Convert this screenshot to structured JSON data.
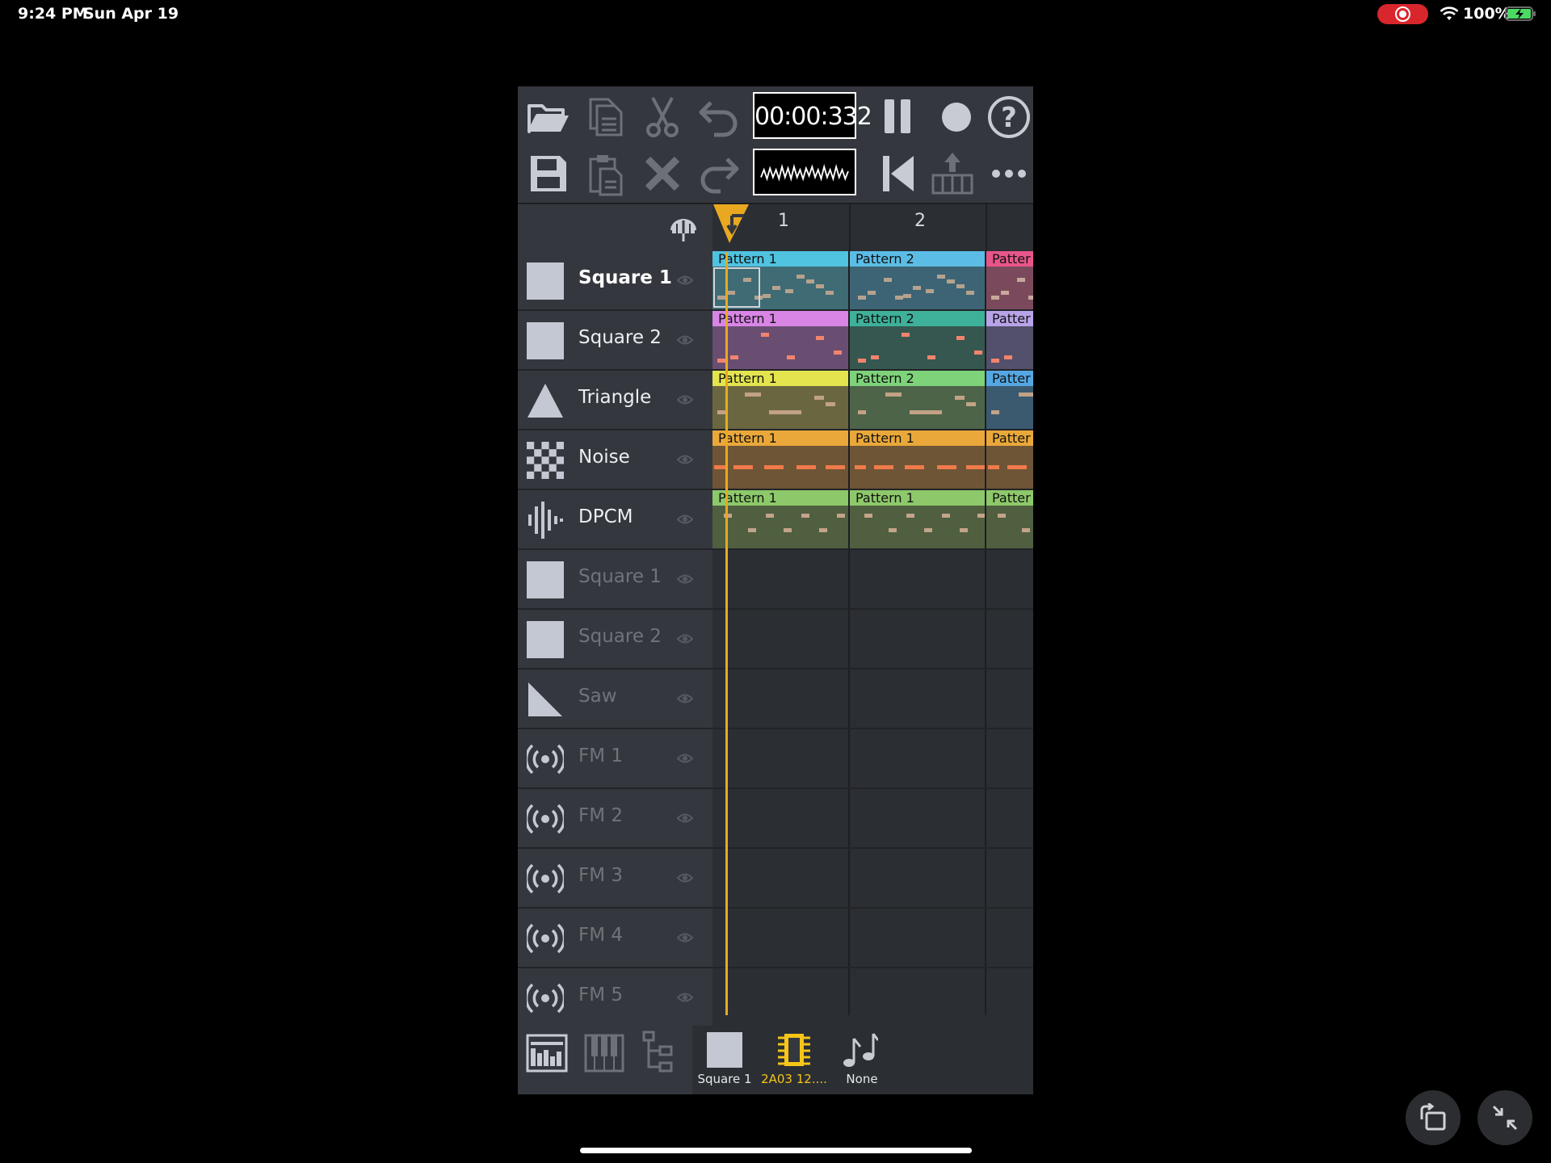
{
  "status_bar": {
    "time": "9:24 PM",
    "date": "Sun Apr 19",
    "battery": "100%"
  },
  "toolbar": {
    "timecode": "00:00:332"
  },
  "header": {
    "bars": [
      "1",
      "2"
    ]
  },
  "channels": [
    {
      "name": "Square 1",
      "icon": "square-wave-icon",
      "state": "active"
    },
    {
      "name": "Square 2",
      "icon": "square-wave-icon",
      "state": "normal"
    },
    {
      "name": "Triangle",
      "icon": "triangle-wave-icon",
      "state": "normal"
    },
    {
      "name": "Noise",
      "icon": "noise-icon",
      "state": "normal"
    },
    {
      "name": "DPCM",
      "icon": "dpcm-icon",
      "state": "normal"
    },
    {
      "name": "Square 1",
      "icon": "square-wave-icon",
      "state": "muted"
    },
    {
      "name": "Square 2",
      "icon": "square-wave-icon",
      "state": "muted"
    },
    {
      "name": "Saw",
      "icon": "saw-wave-icon",
      "state": "muted"
    },
    {
      "name": "FM 1",
      "icon": "fm-icon",
      "state": "muted"
    },
    {
      "name": "FM 2",
      "icon": "fm-icon",
      "state": "muted"
    },
    {
      "name": "FM 3",
      "icon": "fm-icon",
      "state": "muted"
    },
    {
      "name": "FM 4",
      "icon": "fm-icon",
      "state": "muted"
    },
    {
      "name": "FM 5",
      "icon": "fm-icon",
      "state": "muted"
    }
  ],
  "patterns": [
    [
      {
        "label": "Pattern 1",
        "color": "#4fc3e0",
        "body": "#3f6b74",
        "note": "#b5a28e"
      },
      {
        "label": "Pattern 2",
        "color": "#5bbde6",
        "body": "#3d6474",
        "note": "#b5a28e"
      },
      {
        "label": "Patter",
        "color": "#e8558a",
        "body": "#7a4a5c",
        "note": "#c9a79a"
      }
    ],
    [
      {
        "label": "Pattern 1",
        "color": "#d985e6",
        "body": "#6a4e72",
        "note": "#f2846e"
      },
      {
        "label": "Pattern 2",
        "color": "#3fb09a",
        "body": "#35574f",
        "note": "#f2846e"
      },
      {
        "label": "Patter",
        "color": "#b8a3e8",
        "body": "#52506a",
        "note": "#f2846e"
      }
    ],
    [
      {
        "label": "Pattern 1",
        "color": "#e3e44e",
        "body": "#6a6740",
        "note": "#c2a286"
      },
      {
        "label": "Pattern 2",
        "color": "#7ed37a",
        "body": "#4d6448",
        "note": "#c2a286"
      },
      {
        "label": "Patter",
        "color": "#55a7e3",
        "body": "#3b5a70",
        "note": "#c2a286"
      }
    ],
    [
      {
        "label": "Pattern 1",
        "color": "#eaa83a",
        "body": "#6e5536",
        "note": "#f07a4a"
      },
      {
        "label": "Pattern 1",
        "color": "#eaa83a",
        "body": "#6e5536",
        "note": "#f07a4a"
      },
      {
        "label": "Patter",
        "color": "#eaa83a",
        "body": "#6e5536",
        "note": "#f07a4a"
      }
    ],
    [
      {
        "label": "Pattern 1",
        "color": "#8dc96a",
        "body": "#4f5f40",
        "note": "#c4a38b"
      },
      {
        "label": "Pattern 1",
        "color": "#8dc96a",
        "body": "#4f5f40",
        "note": "#c4a38b"
      },
      {
        "label": "Patter",
        "color": "#8dc96a",
        "body": "#4f5f40",
        "note": "#c4a38b"
      }
    ]
  ],
  "bottom_bar": {
    "instrument": "Square 1",
    "expansion": "2A03 12....",
    "arpeggio": "None",
    "expansion_color": "#f5c518"
  }
}
